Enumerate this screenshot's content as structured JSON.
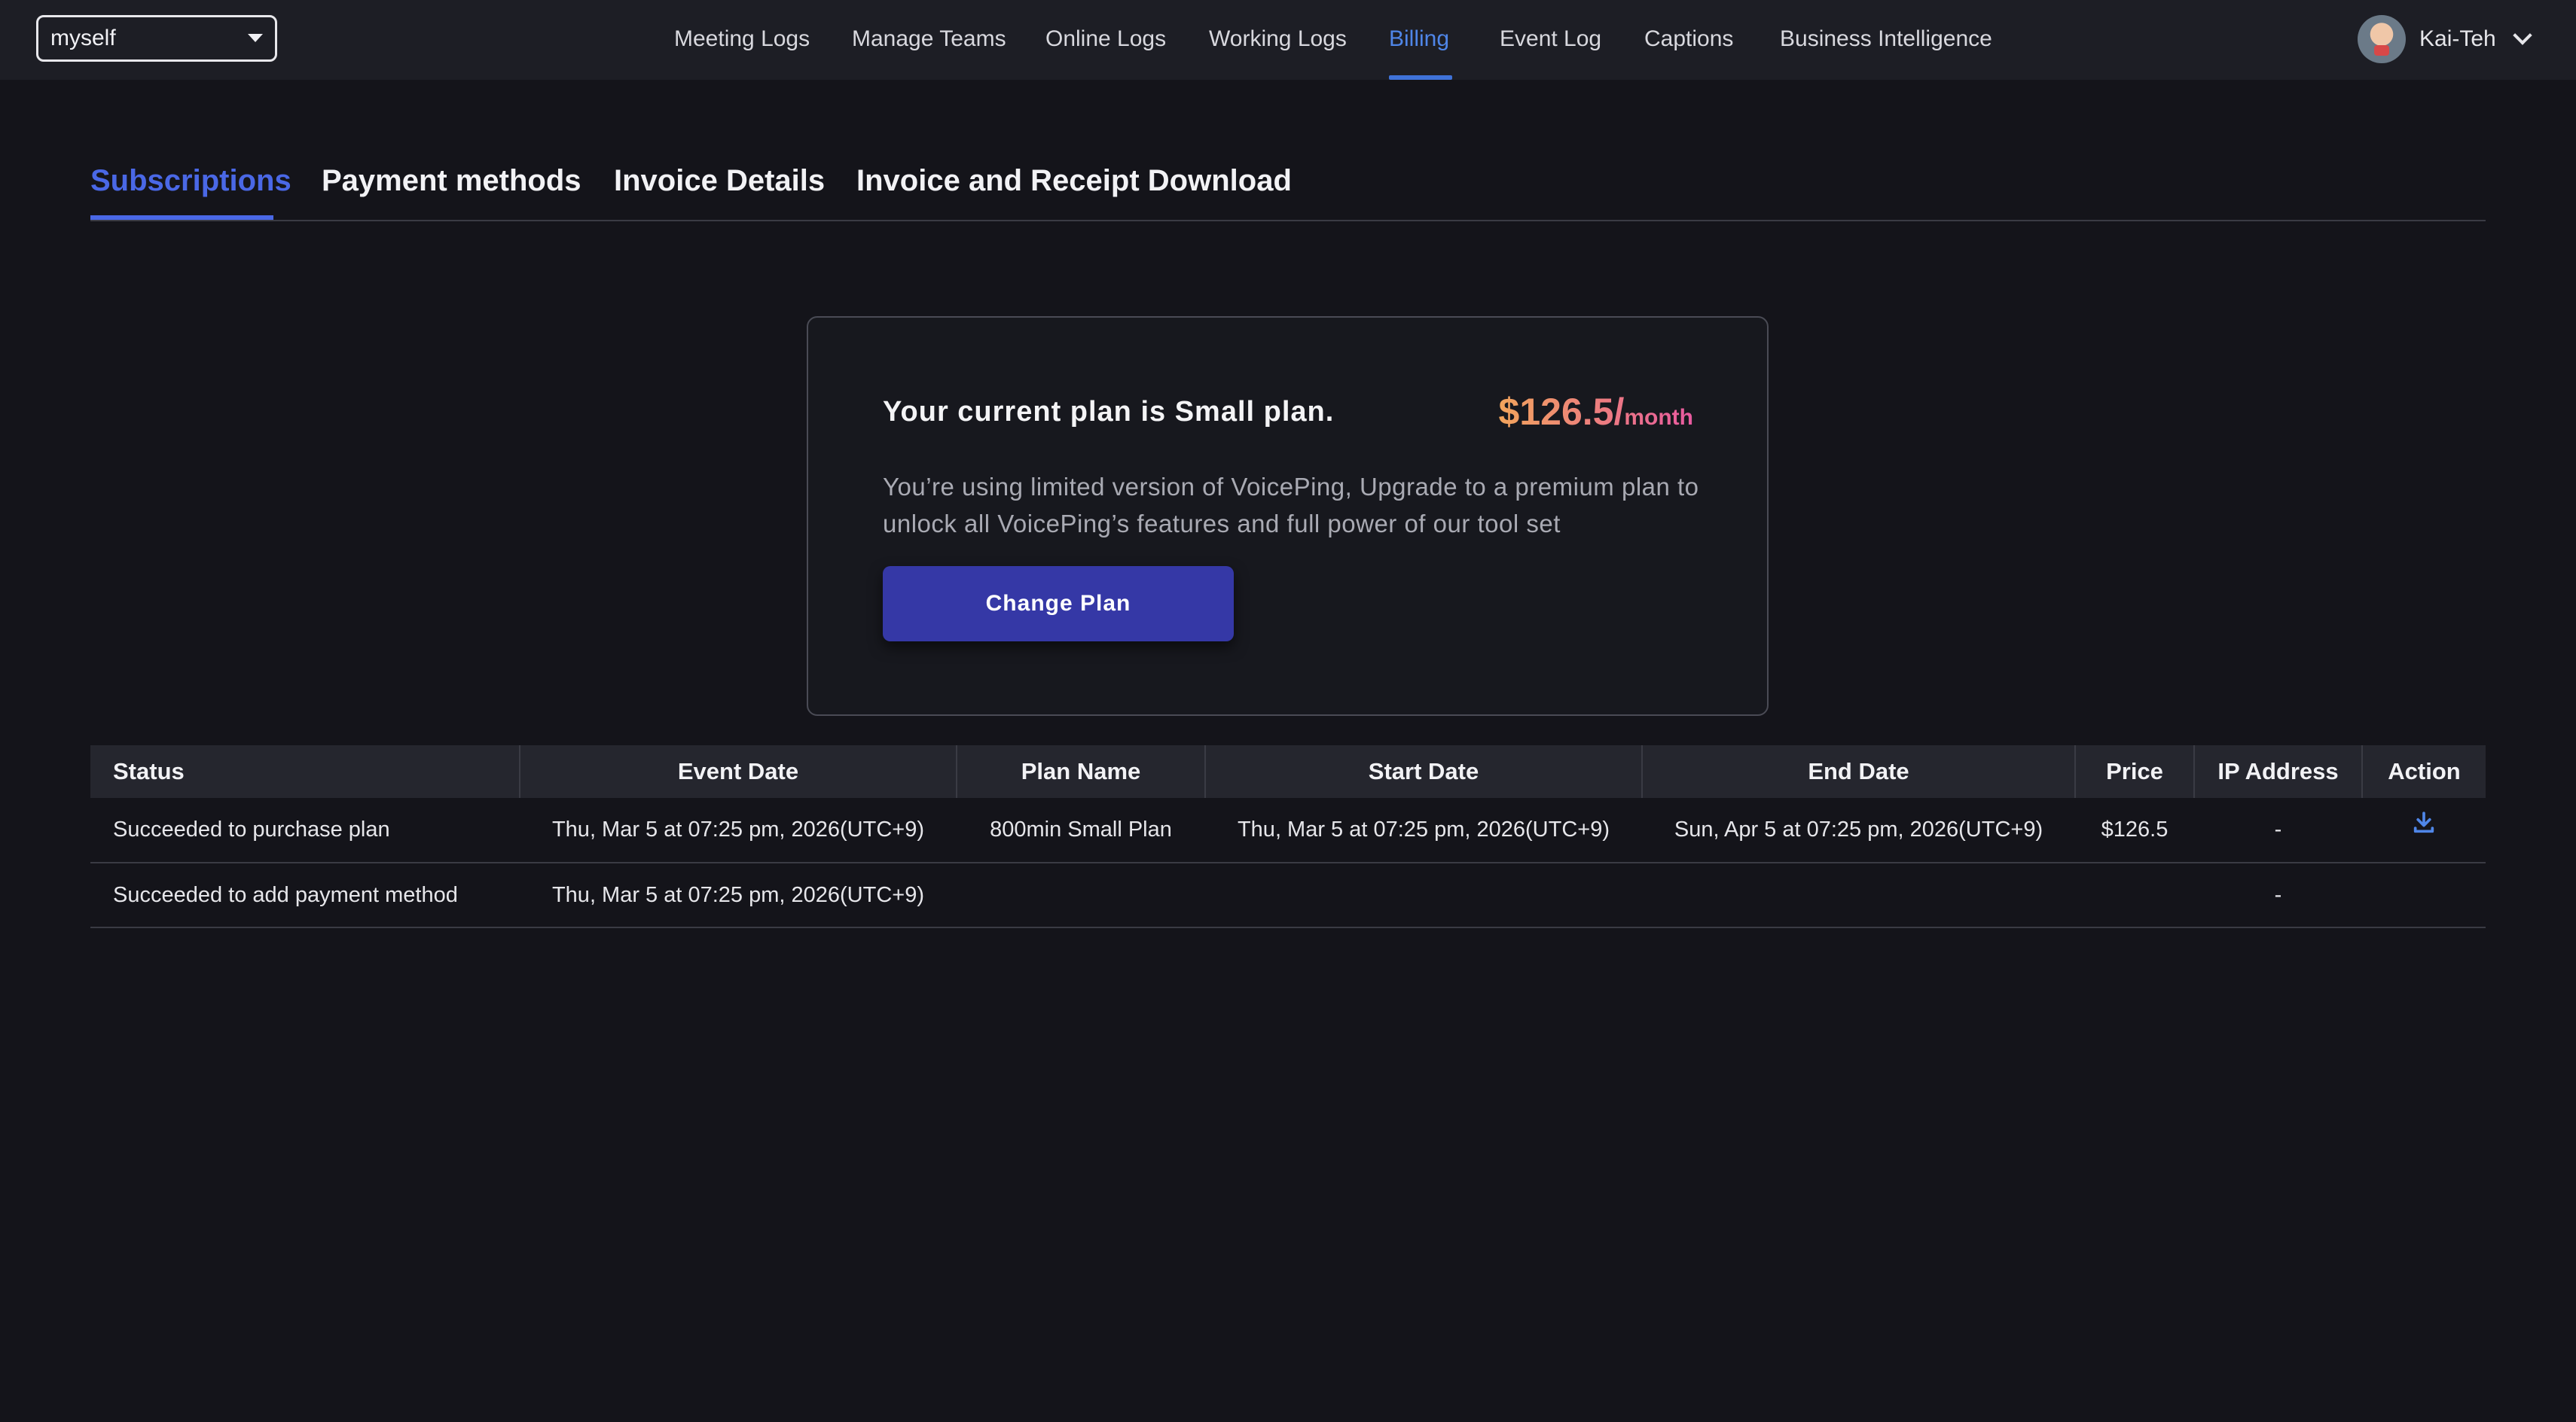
{
  "topbar": {
    "workspace_select": "myself",
    "nav": [
      {
        "label": "Meeting Logs"
      },
      {
        "label": "Manage Teams"
      },
      {
        "label": "Online Logs"
      },
      {
        "label": "Working Logs"
      },
      {
        "label": "Billing",
        "active": true
      },
      {
        "label": "Event Log"
      },
      {
        "label": "Captions"
      },
      {
        "label": "Business Intelligence"
      }
    ],
    "user_name": "Kai-Teh"
  },
  "subtabs": [
    {
      "label": "Subscriptions",
      "active": true
    },
    {
      "label": "Payment methods"
    },
    {
      "label": "Invoice Details"
    },
    {
      "label": "Invoice and Receipt Download"
    }
  ],
  "plan": {
    "title": "Your current plan is Small plan.",
    "price": "$126.5/",
    "period": "month",
    "description": "You’re using limited version of VoicePing, Upgrade to a premium plan to unlock all VoicePing’s features and full power of our tool set",
    "button_label": "Change Plan"
  },
  "table": {
    "headers": [
      "Status",
      "Event Date",
      "Plan Name",
      "Start Date",
      "End Date",
      "Price",
      "IP Address",
      "Action"
    ],
    "rows": [
      {
        "status": "Succeeded to purchase plan",
        "event_date": "Thu, Mar 5 at 07:25 pm, 2026(UTC+9)",
        "plan_name": "800min Small Plan",
        "start_date": "Thu, Mar 5 at 07:25 pm, 2026(UTC+9)",
        "end_date": "Sun, Apr 5 at 07:25 pm, 2026(UTC+9)",
        "price": "$126.5",
        "ip_address": "-",
        "action_icon": "download-icon"
      },
      {
        "status": "Succeeded to add payment method",
        "event_date": "Thu, Mar 5 at 07:25 pm, 2026(UTC+9)",
        "plan_name": "",
        "start_date": "",
        "end_date": "",
        "price": "",
        "ip_address": "-",
        "action_icon": ""
      }
    ]
  },
  "colors": {
    "background": "#14141a",
    "topbar": "#1d1e25",
    "accent_nav": "#4f86e8",
    "accent_tab": "#4a68e6",
    "button": "#3538a6",
    "price_gradient_start": "#f2a45c",
    "price_gradient_end": "#e85aa0"
  }
}
